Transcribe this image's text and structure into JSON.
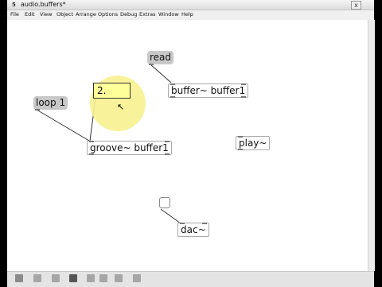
{
  "window": {
    "app_icon": "5",
    "title": "audio.buffers*",
    "close_label": "x"
  },
  "menubar": {
    "items": [
      {
        "label": "File"
      },
      {
        "label": "Edit"
      },
      {
        "label": "View"
      },
      {
        "label": "Object"
      },
      {
        "label": "Arrange"
      },
      {
        "label": "Options"
      },
      {
        "label": "Debug"
      },
      {
        "label": "Extras"
      },
      {
        "label": "Window"
      },
      {
        "label": "Help"
      }
    ]
  },
  "patch": {
    "read_message": "read",
    "buffer_object": "buffer~ buffer1",
    "number_box_value": "2.",
    "loop_message": "loop 1",
    "groove_object": "groove~ buffer1",
    "play_object": "play~",
    "dac_object": "dac~"
  },
  "colors": {
    "highlight": "#f7f28f",
    "number_box_fill": "#ffff9a",
    "message_fill": "#c8c8c8"
  },
  "toolbar": {
    "icons": [
      "lock-icon",
      "add-icon",
      "grid-icon",
      "save-icon",
      "align-icon",
      "window-icon",
      "present-icon",
      "view-icon"
    ]
  }
}
